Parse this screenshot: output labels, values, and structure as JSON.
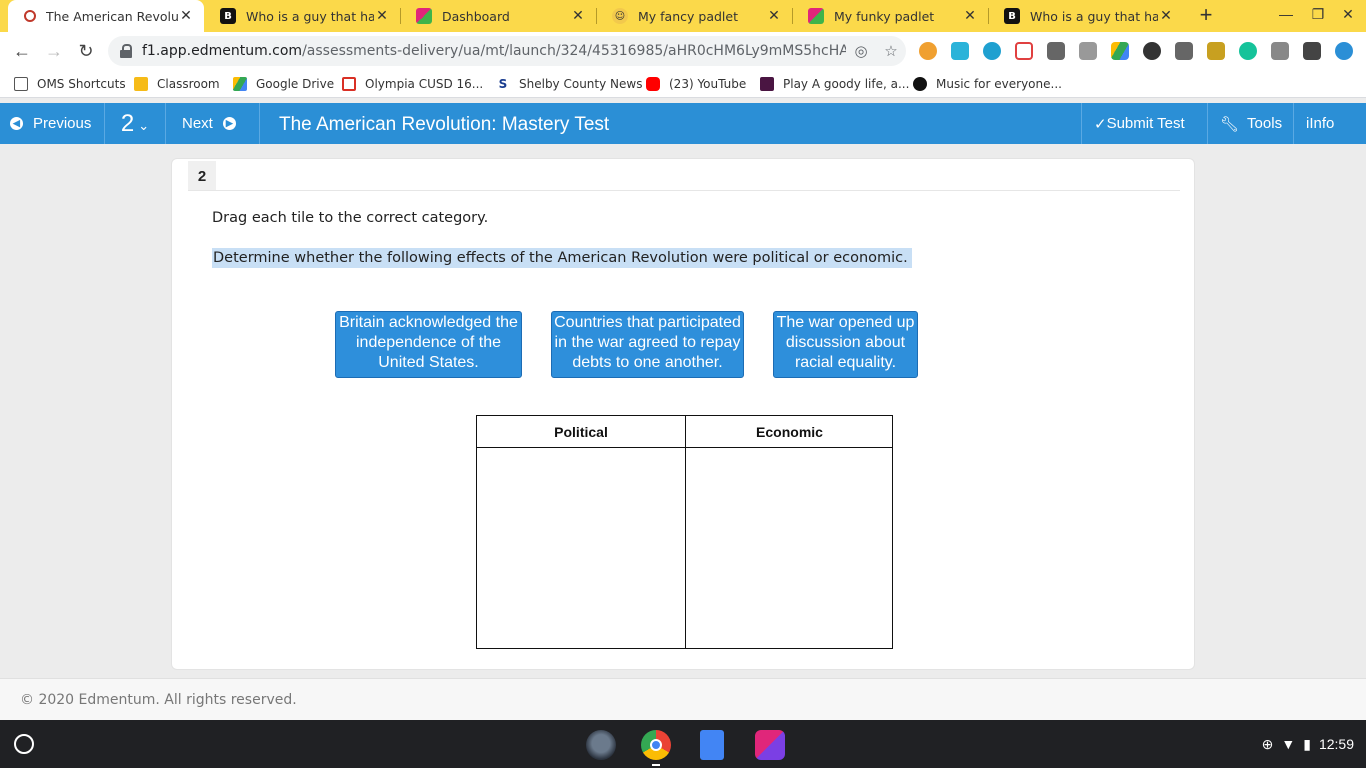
{
  "browser": {
    "tabs": [
      {
        "title": "The American Revolution",
        "favicon": "edmentum-icon",
        "active": true
      },
      {
        "title": "Who is a guy that has Bl",
        "favicon": "brainly-icon",
        "active": false
      },
      {
        "title": "Dashboard",
        "favicon": "padlet-icon",
        "active": false
      },
      {
        "title": "My fancy padlet",
        "favicon": "emoji-icon",
        "active": false
      },
      {
        "title": "My funky padlet",
        "favicon": "padlet-icon",
        "active": false
      },
      {
        "title": "Who is a guy that has Bl",
        "favicon": "brainly-icon",
        "active": false
      }
    ],
    "url_domain": "f1.app.edmentum.com",
    "url_path": "/assessments-delivery/ua/mt/launch/324/45316985/aHR0cHM6Ly9mMS5hcHAuZW...",
    "bookmarks": [
      {
        "label": "OMS Shortcuts",
        "icon": "folder-icon"
      },
      {
        "label": "Classroom",
        "icon": "classroom-icon"
      },
      {
        "label": "Google Drive",
        "icon": "drive-icon"
      },
      {
        "label": "Olympia CUSD 16...",
        "icon": "gmail-icon"
      },
      {
        "label": "Shelby County News",
        "icon": "news-icon"
      },
      {
        "label": "(23) YouTube",
        "icon": "youtube-icon"
      },
      {
        "label": "Play A goody life, a...",
        "icon": "game-icon"
      },
      {
        "label": "Music for everyone...",
        "icon": "spotify-icon"
      }
    ]
  },
  "header": {
    "previous_label": "Previous",
    "question_selector": "2",
    "next_label": "Next",
    "title": "The American Revolution: Mastery Test",
    "submit_label": "Submit Test",
    "tools_label": "Tools",
    "info_label": "Info"
  },
  "question": {
    "number": "2",
    "instruction": "Drag each tile to the correct category.",
    "prompt": "Determine whether the following effects of the American Revolution were political or economic.",
    "tiles": [
      "Britain acknowledged the independence of the United States.",
      "Countries that participated in the war agreed to repay debts to one another.",
      "The war opened up discussion about racial equality."
    ],
    "categories": [
      "Political",
      "Economic"
    ]
  },
  "footer": {
    "copyright": "© 2020 Edmentum. All rights reserved."
  },
  "shelf": {
    "time": "12:59"
  },
  "colors": {
    "header_blue": "#2b8fd6",
    "tile_blue": "#2e8fdb",
    "tabstrip_yellow": "#fbd94a",
    "highlight": "#c8dff5"
  }
}
